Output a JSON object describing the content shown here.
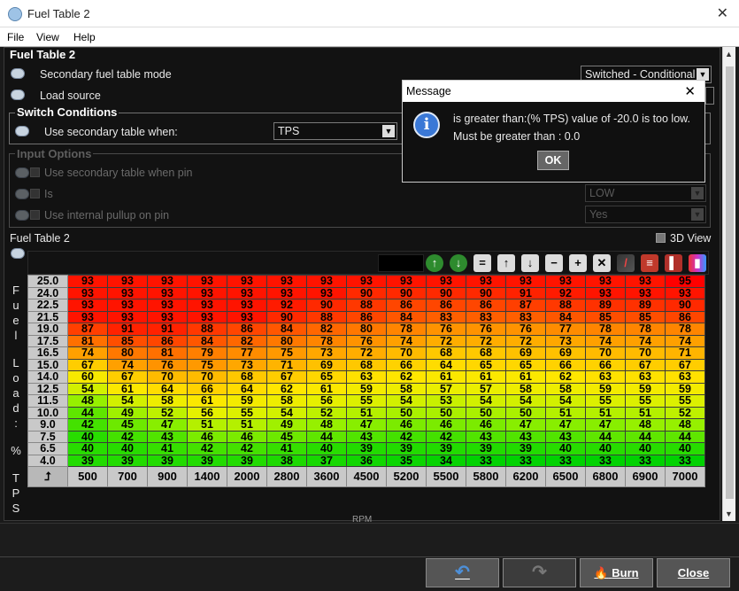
{
  "window": {
    "title": "Fuel Table 2",
    "close_glyph": "✕"
  },
  "menu": [
    "File",
    "View",
    "Help"
  ],
  "panel_title": "Fuel Table 2",
  "settings": {
    "mode_label": "Secondary fuel table mode",
    "mode_value": "Switched - Conditional",
    "load_label": "Load source"
  },
  "switch_conditions": {
    "title": "Switch Conditions",
    "use_label": "Use secondary table when:",
    "use_value": "TPS"
  },
  "input_options": {
    "title": "Input Options",
    "pin_label": "Use secondary table when pin",
    "is_label": "Is",
    "is_value": "LOW",
    "pullup_label": "Use internal pullup on pin",
    "pullup_value": "Yes"
  },
  "table": {
    "title": "Fuel Table 2",
    "view3d_label": "3D View",
    "y_axis_label": "Fuel Load: % TPS",
    "x_axis_label": "RPM",
    "y_bins": [
      "25.0",
      "24.0",
      "22.5",
      "21.5",
      "19.0",
      "17.5",
      "16.5",
      "15.0",
      "14.0",
      "12.5",
      "11.5",
      "10.0",
      "9.0",
      "7.5",
      "6.5",
      "4.0"
    ],
    "x_bins": [
      "500",
      "700",
      "900",
      "1400",
      "2000",
      "2800",
      "3600",
      "4500",
      "5200",
      "5500",
      "5800",
      "6200",
      "6500",
      "6800",
      "6900",
      "7000"
    ],
    "values": [
      [
        93,
        93,
        93,
        93,
        93,
        93,
        93,
        93,
        93,
        93,
        93,
        93,
        93,
        93,
        93,
        95
      ],
      [
        93,
        93,
        93,
        93,
        93,
        93,
        93,
        90,
        90,
        90,
        90,
        91,
        92,
        93,
        93,
        93
      ],
      [
        93,
        93,
        93,
        93,
        93,
        92,
        90,
        88,
        86,
        86,
        86,
        87,
        88,
        89,
        89,
        90
      ],
      [
        93,
        93,
        93,
        93,
        93,
        90,
        88,
        86,
        84,
        83,
        83,
        83,
        84,
        85,
        85,
        86
      ],
      [
        87,
        91,
        91,
        88,
        86,
        84,
        82,
        80,
        78,
        76,
        76,
        76,
        77,
        78,
        78,
        78
      ],
      [
        81,
        85,
        86,
        84,
        82,
        80,
        78,
        76,
        74,
        72,
        72,
        72,
        73,
        74,
        74,
        74
      ],
      [
        74,
        80,
        81,
        79,
        77,
        75,
        73,
        72,
        70,
        68,
        68,
        69,
        69,
        70,
        70,
        71
      ],
      [
        67,
        74,
        76,
        75,
        73,
        71,
        69,
        68,
        66,
        64,
        65,
        65,
        66,
        66,
        67,
        67
      ],
      [
        60,
        67,
        70,
        70,
        68,
        67,
        65,
        63,
        62,
        61,
        61,
        61,
        62,
        63,
        63,
        63
      ],
      [
        54,
        61,
        64,
        66,
        64,
        62,
        61,
        59,
        58,
        57,
        57,
        58,
        58,
        59,
        59,
        59
      ],
      [
        48,
        54,
        58,
        61,
        59,
        58,
        56,
        55,
        54,
        53,
        54,
        54,
        54,
        55,
        55,
        55
      ],
      [
        44,
        49,
        52,
        56,
        55,
        54,
        52,
        51,
        50,
        50,
        50,
        50,
        51,
        51,
        51,
        52
      ],
      [
        42,
        45,
        47,
        51,
        51,
        49,
        48,
        47,
        46,
        46,
        46,
        47,
        47,
        47,
        48,
        48
      ],
      [
        40,
        42,
        43,
        46,
        46,
        45,
        44,
        43,
        42,
        42,
        43,
        43,
        43,
        44,
        44,
        44
      ],
      [
        40,
        40,
        41,
        42,
        42,
        41,
        40,
        39,
        39,
        39,
        39,
        39,
        40,
        40,
        40,
        40
      ],
      [
        39,
        39,
        39,
        39,
        39,
        38,
        37,
        36,
        35,
        34,
        33,
        33,
        33,
        33,
        33,
        33
      ]
    ],
    "toolbar_icons": [
      "up-green-icon",
      "down-green-icon",
      "equals-icon",
      "increase-icon",
      "decrease-icon",
      "minus-icon",
      "plus-icon",
      "multiply-icon",
      "pen-icon",
      "color-scale-icon",
      "bars-icon",
      "gradient-icon"
    ],
    "toolbar_glyphs": [
      "↑",
      "↓",
      "=",
      "↑",
      "↓",
      "−",
      "+",
      "✕",
      "/",
      "≡",
      "▌",
      "▮"
    ],
    "corner_glyph": "⮥"
  },
  "dialog": {
    "title": "Message",
    "close_glyph": "✕",
    "line1": "is greater than:(% TPS) value of -20.0 is too low.",
    "line2": "Must be greater than : 0.0",
    "ok_label": "OK",
    "icon": "i"
  },
  "buttons": {
    "burn": "Burn",
    "close": "Close"
  }
}
